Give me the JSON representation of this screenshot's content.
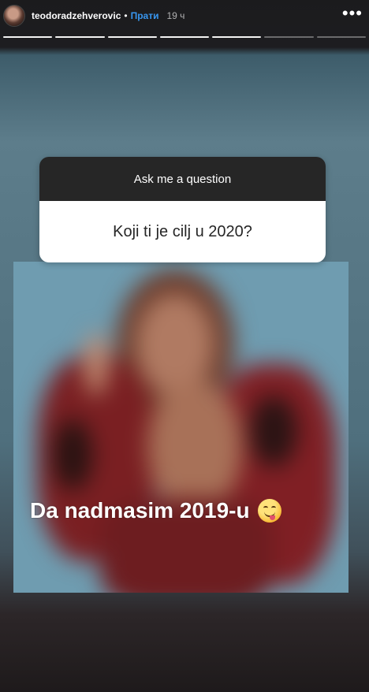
{
  "header": {
    "username": "teodoradzehverovic",
    "separator": "•",
    "follow_label": "Прати",
    "time_label": "19 ч",
    "more_label": "•••"
  },
  "progress": {
    "segments": 7,
    "completed": 5
  },
  "question_sticker": {
    "prompt": "Ask me a question",
    "question": "Koji ti je cilj u 2020?"
  },
  "answer": {
    "text": "Da nadmasim 2019-u"
  },
  "icons": {
    "more": "more-horizontal-icon",
    "emoji": "face-savoring-food-emoji-icon",
    "avatar": "profile-avatar"
  },
  "colors": {
    "follow": "#3897f0",
    "sticker_header": "#262626",
    "sticker_body": "#ffffff"
  }
}
